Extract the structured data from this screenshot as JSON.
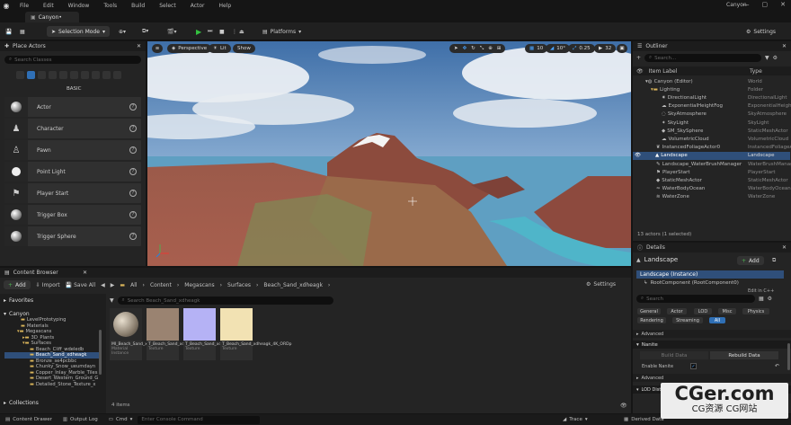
{
  "menu": {
    "items": [
      "File",
      "Edit",
      "Window",
      "Tools",
      "Build",
      "Select",
      "Actor",
      "Help"
    ],
    "project_title": "Canyon"
  },
  "tabs": {
    "project": "Canyon•"
  },
  "toolbar": {
    "selection_mode": "Selection Mode",
    "platforms": "Platforms",
    "settings": "Settings"
  },
  "place_actors": {
    "title": "Place Actors",
    "search_placeholder": "Search Classes",
    "category": "BASIC",
    "items": [
      "Actor",
      "Character",
      "Pawn",
      "Point Light",
      "Player Start",
      "Trigger Box",
      "Trigger Sphere"
    ]
  },
  "viewport": {
    "perspective": "Perspective",
    "lit": "Lit",
    "show": "Show",
    "grid": "10",
    "angle": "10°",
    "scale": "0.25",
    "speed": "32"
  },
  "outliner": {
    "title": "Outliner",
    "search_placeholder": "Search...",
    "col_label": "Item Label",
    "col_type": "Type",
    "rows": [
      {
        "label": "Canyon (Editor)",
        "type": "World"
      },
      {
        "label": "Lighting",
        "type": "Folder"
      },
      {
        "label": "DirectionalLight",
        "type": "DirectionalLight"
      },
      {
        "label": "ExponentialHeightFog",
        "type": "ExponentialHeightFog"
      },
      {
        "label": "SkyAtmosphere",
        "type": "SkyAtmosphere"
      },
      {
        "label": "SkyLight",
        "type": "SkyLight"
      },
      {
        "label": "SM_SkySphere",
        "type": "StaticMeshActor"
      },
      {
        "label": "VolumetricCloud",
        "type": "VolumetricCloud"
      },
      {
        "label": "InstancedFoliageActor0",
        "type": "InstancedFoliageActor"
      },
      {
        "label": "Landscape",
        "type": "Landscape"
      },
      {
        "label": "Landscape_WaterBrushManager",
        "type": "WaterBrushManager"
      },
      {
        "label": "PlayerStart",
        "type": "PlayerStart"
      },
      {
        "label": "StaticMeshActor",
        "type": "StaticMeshActor"
      },
      {
        "label": "WaterBodyOcean",
        "type": "WaterBodyOcean"
      },
      {
        "label": "WaterZone",
        "type": "WaterZone"
      }
    ],
    "footer": "13 actors (1 selected)"
  },
  "details": {
    "title": "Details",
    "actor_name": "Landscape",
    "add": "Add",
    "instance": "Landscape (Instance)",
    "root": "RootComponent (RootComponent0)",
    "edit_cpp": "Edit in C++",
    "search_placeholder": "Search",
    "chips": [
      "General",
      "Actor",
      "LOD",
      "Misc",
      "Physics",
      "Rendering",
      "Streaming",
      "All"
    ],
    "advanced": "Advanced",
    "nanite": "Nanite",
    "build_data": "Build Data",
    "rebuild_data": "Rebuild Data",
    "enable_nanite": "Enable Nanite",
    "advanced2": "Advanced",
    "lod_dist": "LOD Dist"
  },
  "content_browser": {
    "title": "Content Browser",
    "add": "Add",
    "import": "Import",
    "save_all": "Save All",
    "path": [
      "All",
      "Content",
      "Megascans",
      "Surfaces",
      "Beach_Sand_xdheagk"
    ],
    "settings": "Settings",
    "favorites": "Favorites",
    "root": "Canyon",
    "search_placeholder": "Search Beach_Sand_xdheagk",
    "tree": [
      "LevelPrototyping",
      "Materials",
      "Megascans",
      "3D_Plants",
      "Surfaces",
      "Beach_Cliff_wdeledb",
      "Beach_Sand_xdheagk",
      "Bronze_se4pcbbc",
      "Chunky_Snow_ueumdayn",
      "Copper_Inlay_Marble_Tiles",
      "Desert_Western_Ground_G",
      "Detailed_Stone_Texture_x"
    ],
    "assets": [
      {
        "name": "MI_Beach_Sand_xdheagk",
        "type": "Material Instance"
      },
      {
        "name": "T_Beach_Sand_xdheagk_4K_D",
        "type": "Texture"
      },
      {
        "name": "T_Beach_Sand_xdheagk_4K_N",
        "type": "Texture"
      },
      {
        "name": "T_Beach_Sand_xdheagk_4K_ORDp",
        "type": "Texture"
      }
    ],
    "count": "4 items",
    "collections": "Collections"
  },
  "status": {
    "content_drawer": "Content Drawer",
    "output_log": "Output Log",
    "cmd": "Cmd",
    "console_placeholder": "Enter Console Command",
    "trace": "Trace",
    "derived": "Derived Data",
    "watermark_main": "CGer.com",
    "watermark_sub": "CG资源 CG网站"
  },
  "colors": {
    "accent": "#2f4f7a",
    "play": "#34c240"
  }
}
